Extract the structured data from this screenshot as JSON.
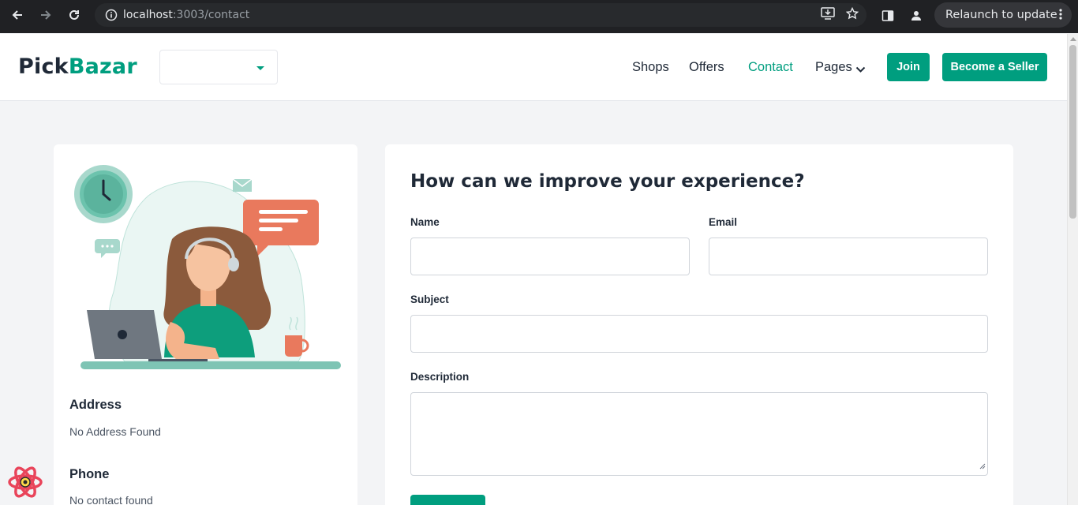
{
  "browser": {
    "url_host": "localhost",
    "url_path": ":3003/contact",
    "relaunch_label": "Relaunch to update"
  },
  "header": {
    "logo_part1": "Pick",
    "logo_part2": "Bazar",
    "type_select_value": "",
    "nav": {
      "shops": "Shops",
      "offers": "Offers",
      "contact": "Contact",
      "pages": "Pages"
    },
    "join_label": "Join",
    "seller_label": "Become a Seller",
    "accent_color": "#009e7f"
  },
  "contact_info": {
    "address_title": "Address",
    "address_value": "No Address Found",
    "phone_title": "Phone",
    "phone_value": "No contact found"
  },
  "form": {
    "title": "How can we improve your experience?",
    "name_label": "Name",
    "email_label": "Email",
    "subject_label": "Subject",
    "description_label": "Description",
    "name_value": "",
    "email_value": "",
    "subject_value": "",
    "description_value": ""
  }
}
